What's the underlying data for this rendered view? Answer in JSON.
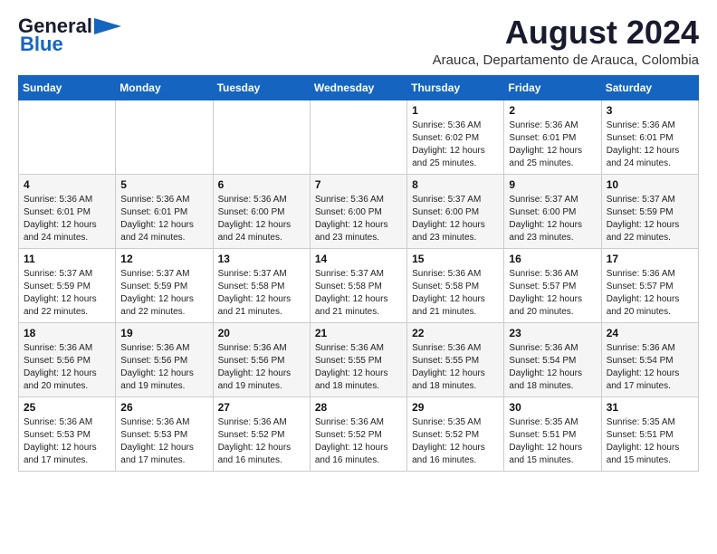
{
  "header": {
    "logo_general": "General",
    "logo_blue": "Blue",
    "main_title": "August 2024",
    "subtitle": "Arauca, Departamento de Arauca, Colombia"
  },
  "calendar": {
    "days_of_week": [
      "Sunday",
      "Monday",
      "Tuesday",
      "Wednesday",
      "Thursday",
      "Friday",
      "Saturday"
    ],
    "weeks": [
      [
        {
          "day": "",
          "info": ""
        },
        {
          "day": "",
          "info": ""
        },
        {
          "day": "",
          "info": ""
        },
        {
          "day": "",
          "info": ""
        },
        {
          "day": "1",
          "info": "Sunrise: 5:36 AM\nSunset: 6:02 PM\nDaylight: 12 hours\nand 25 minutes."
        },
        {
          "day": "2",
          "info": "Sunrise: 5:36 AM\nSunset: 6:01 PM\nDaylight: 12 hours\nand 25 minutes."
        },
        {
          "day": "3",
          "info": "Sunrise: 5:36 AM\nSunset: 6:01 PM\nDaylight: 12 hours\nand 24 minutes."
        }
      ],
      [
        {
          "day": "4",
          "info": "Sunrise: 5:36 AM\nSunset: 6:01 PM\nDaylight: 12 hours\nand 24 minutes."
        },
        {
          "day": "5",
          "info": "Sunrise: 5:36 AM\nSunset: 6:01 PM\nDaylight: 12 hours\nand 24 minutes."
        },
        {
          "day": "6",
          "info": "Sunrise: 5:36 AM\nSunset: 6:00 PM\nDaylight: 12 hours\nand 24 minutes."
        },
        {
          "day": "7",
          "info": "Sunrise: 5:36 AM\nSunset: 6:00 PM\nDaylight: 12 hours\nand 23 minutes."
        },
        {
          "day": "8",
          "info": "Sunrise: 5:37 AM\nSunset: 6:00 PM\nDaylight: 12 hours\nand 23 minutes."
        },
        {
          "day": "9",
          "info": "Sunrise: 5:37 AM\nSunset: 6:00 PM\nDaylight: 12 hours\nand 23 minutes."
        },
        {
          "day": "10",
          "info": "Sunrise: 5:37 AM\nSunset: 5:59 PM\nDaylight: 12 hours\nand 22 minutes."
        }
      ],
      [
        {
          "day": "11",
          "info": "Sunrise: 5:37 AM\nSunset: 5:59 PM\nDaylight: 12 hours\nand 22 minutes."
        },
        {
          "day": "12",
          "info": "Sunrise: 5:37 AM\nSunset: 5:59 PM\nDaylight: 12 hours\nand 22 minutes."
        },
        {
          "day": "13",
          "info": "Sunrise: 5:37 AM\nSunset: 5:58 PM\nDaylight: 12 hours\nand 21 minutes."
        },
        {
          "day": "14",
          "info": "Sunrise: 5:37 AM\nSunset: 5:58 PM\nDaylight: 12 hours\nand 21 minutes."
        },
        {
          "day": "15",
          "info": "Sunrise: 5:36 AM\nSunset: 5:58 PM\nDaylight: 12 hours\nand 21 minutes."
        },
        {
          "day": "16",
          "info": "Sunrise: 5:36 AM\nSunset: 5:57 PM\nDaylight: 12 hours\nand 20 minutes."
        },
        {
          "day": "17",
          "info": "Sunrise: 5:36 AM\nSunset: 5:57 PM\nDaylight: 12 hours\nand 20 minutes."
        }
      ],
      [
        {
          "day": "18",
          "info": "Sunrise: 5:36 AM\nSunset: 5:56 PM\nDaylight: 12 hours\nand 20 minutes."
        },
        {
          "day": "19",
          "info": "Sunrise: 5:36 AM\nSunset: 5:56 PM\nDaylight: 12 hours\nand 19 minutes."
        },
        {
          "day": "20",
          "info": "Sunrise: 5:36 AM\nSunset: 5:56 PM\nDaylight: 12 hours\nand 19 minutes."
        },
        {
          "day": "21",
          "info": "Sunrise: 5:36 AM\nSunset: 5:55 PM\nDaylight: 12 hours\nand 18 minutes."
        },
        {
          "day": "22",
          "info": "Sunrise: 5:36 AM\nSunset: 5:55 PM\nDaylight: 12 hours\nand 18 minutes."
        },
        {
          "day": "23",
          "info": "Sunrise: 5:36 AM\nSunset: 5:54 PM\nDaylight: 12 hours\nand 18 minutes."
        },
        {
          "day": "24",
          "info": "Sunrise: 5:36 AM\nSunset: 5:54 PM\nDaylight: 12 hours\nand 17 minutes."
        }
      ],
      [
        {
          "day": "25",
          "info": "Sunrise: 5:36 AM\nSunset: 5:53 PM\nDaylight: 12 hours\nand 17 minutes."
        },
        {
          "day": "26",
          "info": "Sunrise: 5:36 AM\nSunset: 5:53 PM\nDaylight: 12 hours\nand 17 minutes."
        },
        {
          "day": "27",
          "info": "Sunrise: 5:36 AM\nSunset: 5:52 PM\nDaylight: 12 hours\nand 16 minutes."
        },
        {
          "day": "28",
          "info": "Sunrise: 5:36 AM\nSunset: 5:52 PM\nDaylight: 12 hours\nand 16 minutes."
        },
        {
          "day": "29",
          "info": "Sunrise: 5:35 AM\nSunset: 5:52 PM\nDaylight: 12 hours\nand 16 minutes."
        },
        {
          "day": "30",
          "info": "Sunrise: 5:35 AM\nSunset: 5:51 PM\nDaylight: 12 hours\nand 15 minutes."
        },
        {
          "day": "31",
          "info": "Sunrise: 5:35 AM\nSunset: 5:51 PM\nDaylight: 12 hours\nand 15 minutes."
        }
      ]
    ]
  }
}
